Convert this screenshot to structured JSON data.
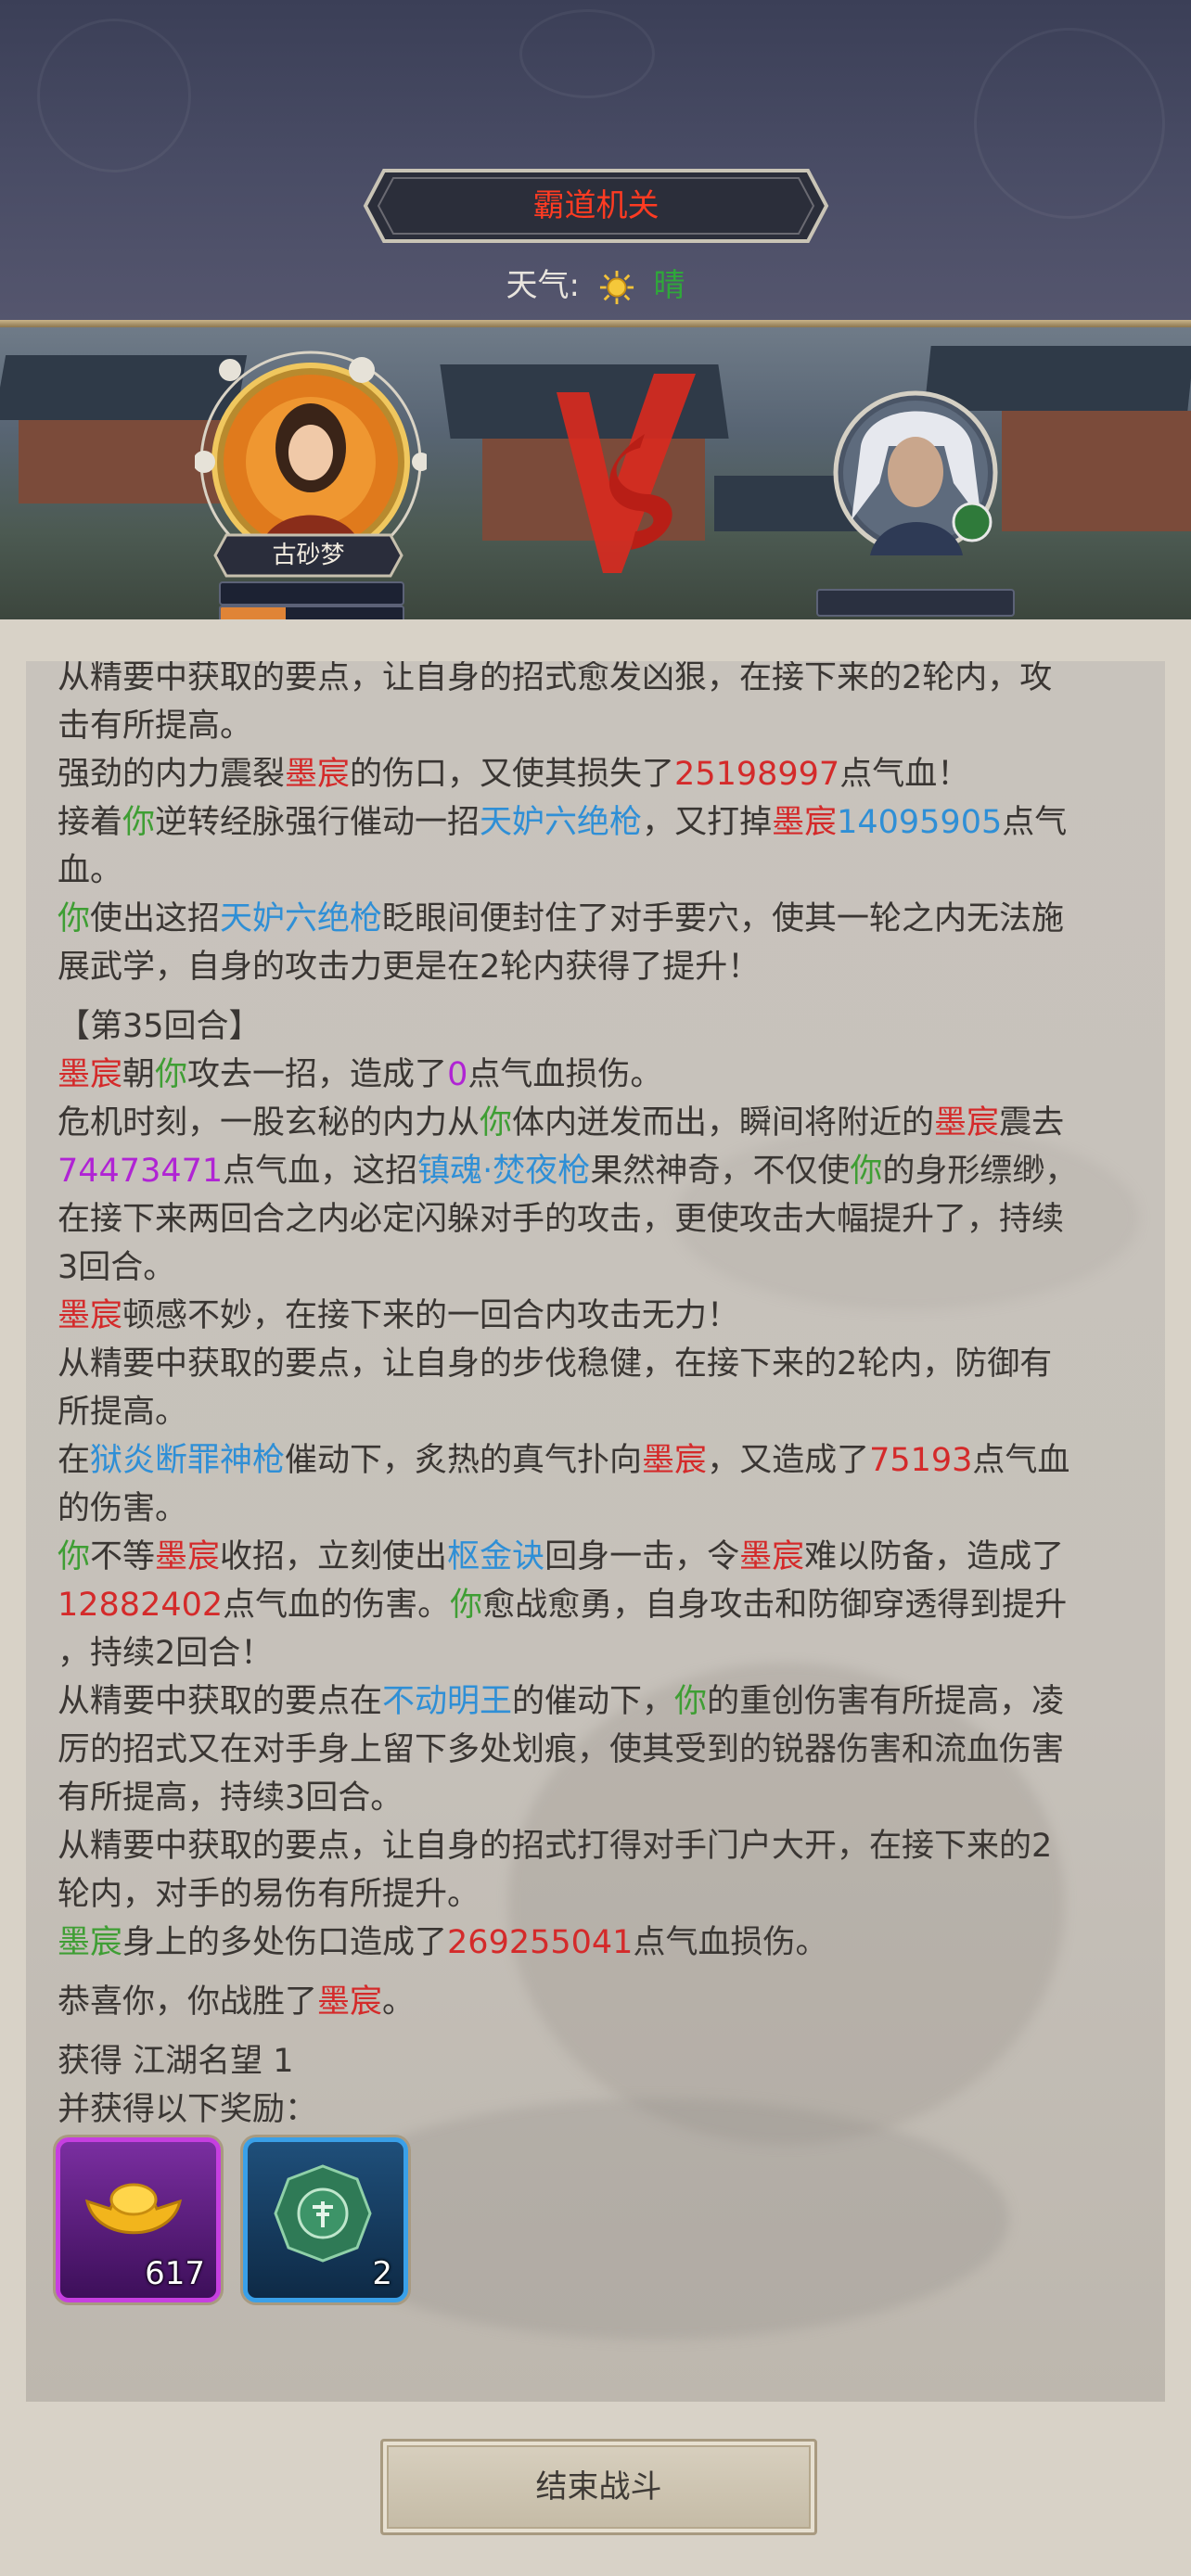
{
  "header": {
    "title": "霸道机关",
    "weather_label": "天气:",
    "weather_value": "晴",
    "weather_icon": "sun-icon"
  },
  "battle": {
    "player_name": "古砂梦",
    "vs_text": "VS"
  },
  "log": {
    "lines": [
      "从精要中获取的要点，让自身的招式愈发凶狠，在接下来的2轮内，攻",
      "击有所提高。"
    ],
    "l3": {
      "a": "强劲的内力震裂",
      "b": "墨宸",
      "c": "的伤口，又使其损失了",
      "d": "25198997",
      "e": "点气血！"
    },
    "l4": {
      "a": "接着",
      "b": "你",
      "c": "逆转经脉强行催动一招",
      "d": "天妒六绝枪",
      "e": "，又打掉",
      "f": "墨宸",
      "g": "14095905",
      "h": "点气"
    },
    "l5": "血。",
    "l6": {
      "a": "你",
      "b": "使出这招",
      "c": "天妒六绝枪",
      "d": "眨眼间便封住了对手要穴，使其一轮之内无法施"
    },
    "l7": "展武学，自身的攻击力更是在2轮内获得了提升！",
    "round": "【第35回合】",
    "l9": {
      "a": "墨宸",
      "b": "朝",
      "c": "你",
      "d": "攻去一招，造成了",
      "e": "0",
      "f": "点气血损伤。"
    },
    "l10": {
      "a": "危机时刻，一股玄秘的内力从",
      "b": "你",
      "c": "体内迸发而出，瞬间将附近的",
      "d": "墨宸",
      "e": "震去"
    },
    "l11": {
      "a": "74473471",
      "b": "点气血，这招",
      "c": "镇魂·焚夜枪",
      "d": "果然神奇，不仅使",
      "e": "你",
      "f": "的身形缥缈，"
    },
    "l12": "在接下来两回合之内必定闪躲对手的攻击，更使攻击大幅提升了，持续",
    "l13": "3回合。",
    "l14": {
      "a": "墨宸",
      "b": "顿感不妙，在接下来的一回合内攻击无力！"
    },
    "l15": "从精要中获取的要点，让自身的步伐稳健，在接下来的2轮内，防御有",
    "l16": "所提高。",
    "l17": {
      "a": "在",
      "b": "狱炎断罪神枪",
      "c": "催动下，炙热的真气扑向",
      "d": "墨宸",
      "e": "，又造成了",
      "f": "75193",
      "g": "点气血"
    },
    "l18": "的伤害。",
    "l19": {
      "a": "你",
      "b": "不等",
      "c": "墨宸",
      "d": "收招，立刻使出",
      "e": "枢金诀",
      "f": "回身一击，令",
      "g": "墨宸",
      "h": "难以防备，造成了"
    },
    "l20": {
      "a": "12882402",
      "b": "点气血的伤害。",
      "c": "你",
      "d": "愈战愈勇，自身攻击和防御穿透得到提升"
    },
    "l21": "，持续2回合！",
    "l22": {
      "a": "从精要中获取的要点在",
      "b": "不动明王",
      "c": "的催动下，",
      "d": "你",
      "e": "的重创伤害有所提高，凌"
    },
    "l23": "厉的招式又在对手身上留下多处划痕，使其受到的锐器伤害和流血伤害",
    "l24": "有所提高，持续3回合。",
    "l25": "从精要中获取的要点，让自身的招式打得对手门户大开，在接下来的2",
    "l26": "轮内，对手的易伤有所提升。",
    "l27": {
      "a": "墨宸",
      "b": "身上的多处伤口造成了",
      "c": "269255041",
      "d": "点气血损伤。"
    },
    "win": {
      "a": "恭喜你，你战胜了",
      "b": "墨宸",
      "c": "。"
    },
    "gain": "获得 江湖名望 1",
    "rewards_label": "并获得以下奖励："
  },
  "rewards": [
    {
      "icon": "gold-ingot-icon",
      "count": "617",
      "frame": "#c63fe0"
    },
    {
      "icon": "jade-token-icon",
      "count": "2",
      "frame": "#3aa0e8"
    }
  ],
  "end_button": "结束战斗",
  "colors": {
    "damage": "#d42a2a",
    "you": "#3f9e34",
    "skill": "#2f8fd6",
    "special": "#b024d4"
  }
}
